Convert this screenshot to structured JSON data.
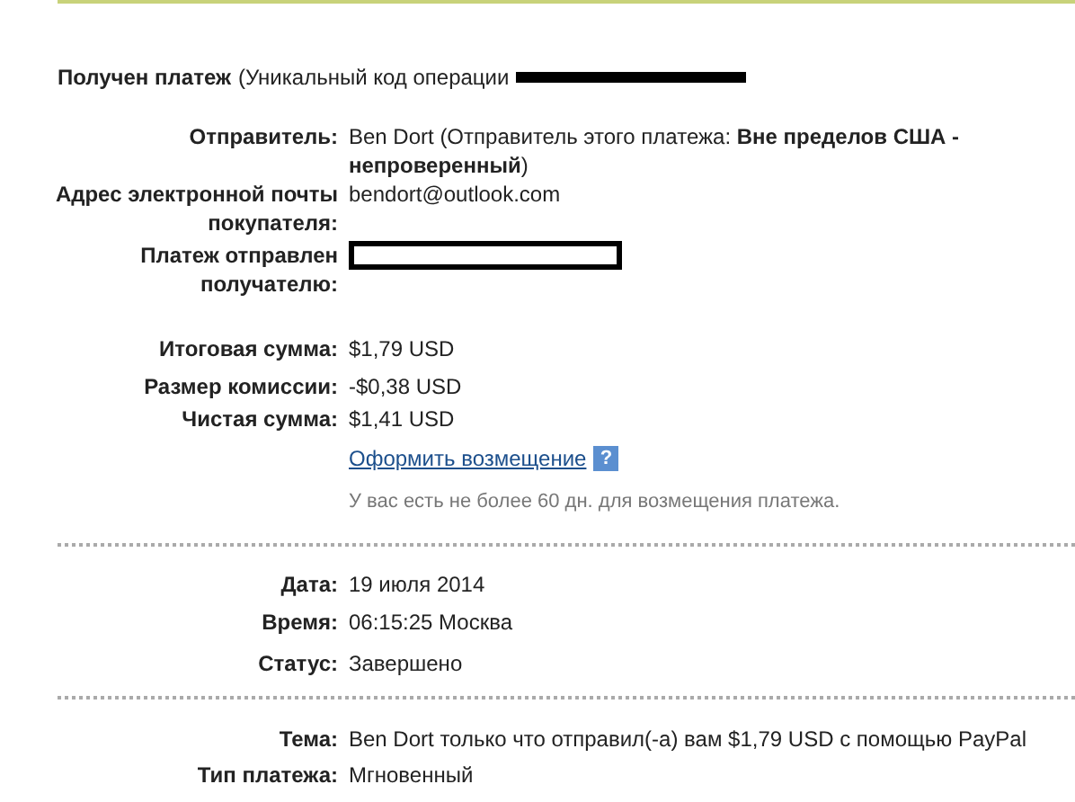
{
  "header": {
    "title": "Получен платеж",
    "note": "(Уникальный код операции",
    "code_redacted": true
  },
  "details": [
    {
      "label": "Отправитель:",
      "kind": "text",
      "value": "Ben Dort (Отправитель этого платежа: **Вне пределов США - непроверенный**)"
    },
    {
      "label": "Адрес электронной почты покупателя:",
      "kind": "text",
      "value": "bendort@outlook.com"
    },
    {
      "label": "Платеж отправлен получателю:",
      "kind": "redacted"
    }
  ],
  "amounts": [
    {
      "label": "Итоговая сумма:",
      "value": "$1,79 USD"
    },
    {
      "label": "Размер комиссии:",
      "value": "-$0,38 USD"
    },
    {
      "label": "Чистая сумма:",
      "value": "$1,41 USD"
    }
  ],
  "refund": {
    "link": "Оформить возмещение",
    "help": "?",
    "note": "У вас есть не более 60 дн. для возмещения платежа."
  },
  "timing": [
    {
      "label": "Дата:",
      "value": "19 июля 2014"
    },
    {
      "label": "Время:",
      "value": "06:15:25 Москва"
    },
    {
      "label": "Статус:",
      "value": "Завершено"
    }
  ],
  "subject": [
    {
      "label": "Тема:",
      "value": "Ben Dort только что отправил(-а) вам $1,79 USD с помощью PayPal"
    },
    {
      "label": "Тип платежа:",
      "value": "Мгновенный"
    }
  ]
}
